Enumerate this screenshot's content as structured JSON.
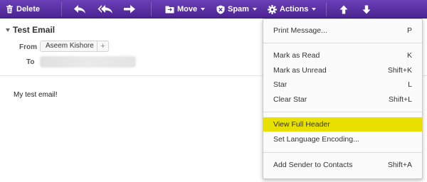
{
  "toolbar": {
    "delete_label": "Delete",
    "move_label": "Move",
    "spam_label": "Spam",
    "actions_label": "Actions",
    "icons": [
      "trash-icon",
      "reply-icon",
      "reply-all-icon",
      "forward-icon",
      "folder-icon",
      "spam-shield-icon",
      "gear-icon",
      "arrow-up-icon",
      "arrow-down-icon"
    ]
  },
  "email": {
    "subject": "Test Email",
    "from_label": "From",
    "sender": "Aseem Kishore",
    "add_symbol": "+",
    "to_label": "To",
    "body": "My test email!"
  },
  "actions_menu": {
    "items": [
      {
        "label": "Print Message...",
        "shortcut": "P"
      },
      {
        "label": "Mark as Read",
        "shortcut": "K"
      },
      {
        "label": "Mark as Unread",
        "shortcut": "Shift+K"
      },
      {
        "label": "Star",
        "shortcut": "L"
      },
      {
        "label": "Clear Star",
        "shortcut": "Shift+L"
      },
      {
        "label": "View Full Header",
        "shortcut": "",
        "highlighted": true
      },
      {
        "label": "Set Language Encoding...",
        "shortcut": ""
      },
      {
        "label": "Add Sender to Contacts",
        "shortcut": "Shift+A"
      }
    ]
  },
  "colors": {
    "toolbar": "#5a2fa3",
    "highlight": "#e8e000"
  }
}
